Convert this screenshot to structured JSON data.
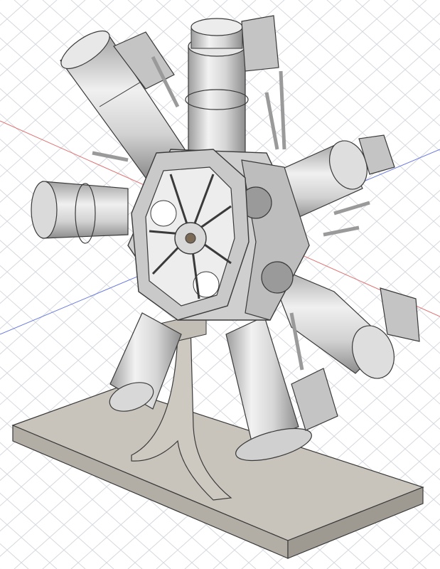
{
  "viewport": {
    "background": "#ffffff",
    "grid_color": "#d5d8de",
    "axis_red": "#d9534f",
    "axis_blue": "#4a5bd6"
  },
  "model": {
    "name": "radial-engine-assembly",
    "cylinder_count": 7,
    "metal_light": "#e3e3e3",
    "metal_mid": "#c6c6c6",
    "metal_dark": "#8e8e8e",
    "base_top": "#c8c4bc",
    "base_side": "#a9a49c",
    "rod_color": "#a8906a",
    "outline": "#3a3a3a"
  }
}
